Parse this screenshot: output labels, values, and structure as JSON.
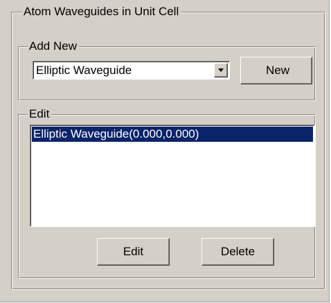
{
  "atom_group": {
    "title": "Atom Waveguides in Unit Cell"
  },
  "add_new": {
    "title": "Add New",
    "selected_type": "Elliptic Waveguide",
    "new_button": "New"
  },
  "edit": {
    "title": "Edit",
    "items": [
      {
        "label": "Elliptic Waveguide(0.000,0.000)",
        "selected": true
      }
    ],
    "edit_button": "Edit",
    "delete_button": "Delete"
  },
  "colors": {
    "face": "#d4d0c8",
    "selection": "#0a246a",
    "list_background": "#ffffff"
  },
  "icons": {
    "dropdown": "dropdown-arrow-icon"
  }
}
